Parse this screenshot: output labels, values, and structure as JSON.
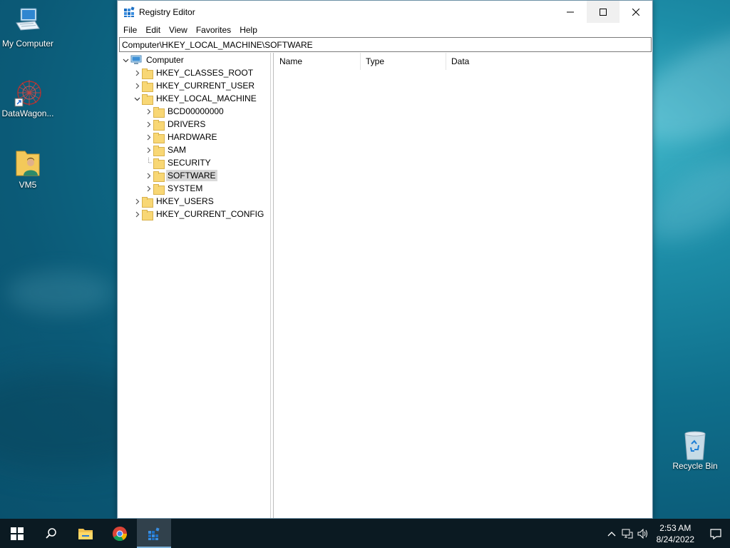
{
  "desktop": {
    "icons": [
      {
        "label": "My Computer"
      },
      {
        "label": "DataWagon..."
      },
      {
        "label": "VM5"
      },
      {
        "label": "Recycle Bin"
      }
    ]
  },
  "window": {
    "title": "Registry Editor",
    "menu": [
      "File",
      "Edit",
      "View",
      "Favorites",
      "Help"
    ],
    "address": "Computer\\HKEY_LOCAL_MACHINE\\SOFTWARE"
  },
  "tree": {
    "root": "Computer",
    "hives": [
      {
        "label": "HKEY_CLASSES_ROOT",
        "expanded": false
      },
      {
        "label": "HKEY_CURRENT_USER",
        "expanded": false
      },
      {
        "label": "HKEY_LOCAL_MACHINE",
        "expanded": true
      },
      {
        "label": "HKEY_USERS",
        "expanded": false
      },
      {
        "label": "HKEY_CURRENT_CONFIG",
        "expanded": false
      }
    ],
    "hklm_children": [
      {
        "label": "BCD00000000",
        "has_children": true
      },
      {
        "label": "DRIVERS",
        "has_children": true
      },
      {
        "label": "HARDWARE",
        "has_children": true
      },
      {
        "label": "SAM",
        "has_children": true
      },
      {
        "label": "SECURITY",
        "has_children": false
      },
      {
        "label": "SOFTWARE",
        "has_children": true,
        "selected": true
      },
      {
        "label": "SYSTEM",
        "has_children": true
      }
    ]
  },
  "list": {
    "columns": [
      "Name",
      "Type",
      "Data"
    ]
  },
  "taskbar": {
    "time": "2:53 AM",
    "date": "8/24/2022"
  }
}
